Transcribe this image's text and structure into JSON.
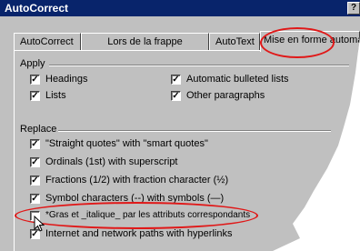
{
  "window": {
    "title": "AutoCorrect",
    "help_glyph": "?"
  },
  "tabs": [
    {
      "label": "AutoCorrect"
    },
    {
      "label": "Lors de la frappe"
    },
    {
      "label": "AutoText"
    },
    {
      "label": "Mise en forme automa",
      "active": true
    }
  ],
  "apply": {
    "label": "Apply",
    "items": [
      {
        "label": "Headings",
        "checked": true
      },
      {
        "label": "Lists",
        "checked": true
      },
      {
        "label": "Automatic bulleted lists",
        "checked": true
      },
      {
        "label": "Other paragraphs",
        "checked": true
      }
    ]
  },
  "replace": {
    "label": "Replace",
    "items": [
      {
        "label": "\"Straight quotes\" with \"smart quotes\"",
        "checked": true
      },
      {
        "label": "Ordinals (1st) with superscript",
        "checked": true
      },
      {
        "label": "Fractions (1/2) with fraction character (½)",
        "checked": true
      },
      {
        "label": "Symbol characters (--) with symbols (—)",
        "checked": true
      },
      {
        "label": "*Gras et _italique_ par les attributs correspondants",
        "checked": false
      },
      {
        "label": "Internet and network paths with hyperlinks",
        "checked": true
      }
    ]
  },
  "check_glyph": "✓",
  "colors": {
    "title_bar": "#08246b",
    "dialog": "#c0c0c0",
    "annotation": "#e01818"
  },
  "icons": {
    "cursor": "arrow-cursor-icon"
  }
}
